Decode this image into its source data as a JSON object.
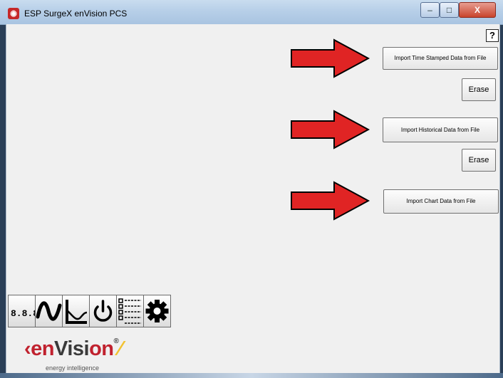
{
  "window": {
    "title": "ESP SurgeX enVision PCS",
    "minimize_symbol": "–",
    "maximize_symbol": "□",
    "close_symbol": "X",
    "help_label": "?"
  },
  "main": {
    "import_time_stamped_label": "Import Time Stamped Data from File",
    "erase1_label": "Erase",
    "import_historical_label": "Import Historical Data from File",
    "erase2_label": "Erase",
    "import_chart_label": "Import Chart Data from File"
  },
  "toolbar": {
    "icons": [
      "digital-display-icon",
      "waveform-icon",
      "trend-chart-icon",
      "power-icon",
      "event-list-icon",
      "gear-icon"
    ]
  },
  "logo": {
    "text_prefix": "‹",
    "text_en": "en",
    "text_vision": "Visi",
    "text_on": "on",
    "reg_mark": "®",
    "sub": "energy intelligence"
  },
  "colors": {
    "arrow_fill": "#e02424",
    "arrow_stroke": "#000000",
    "logo_red": "#c0212e",
    "logo_gray": "#3a3a3a"
  }
}
